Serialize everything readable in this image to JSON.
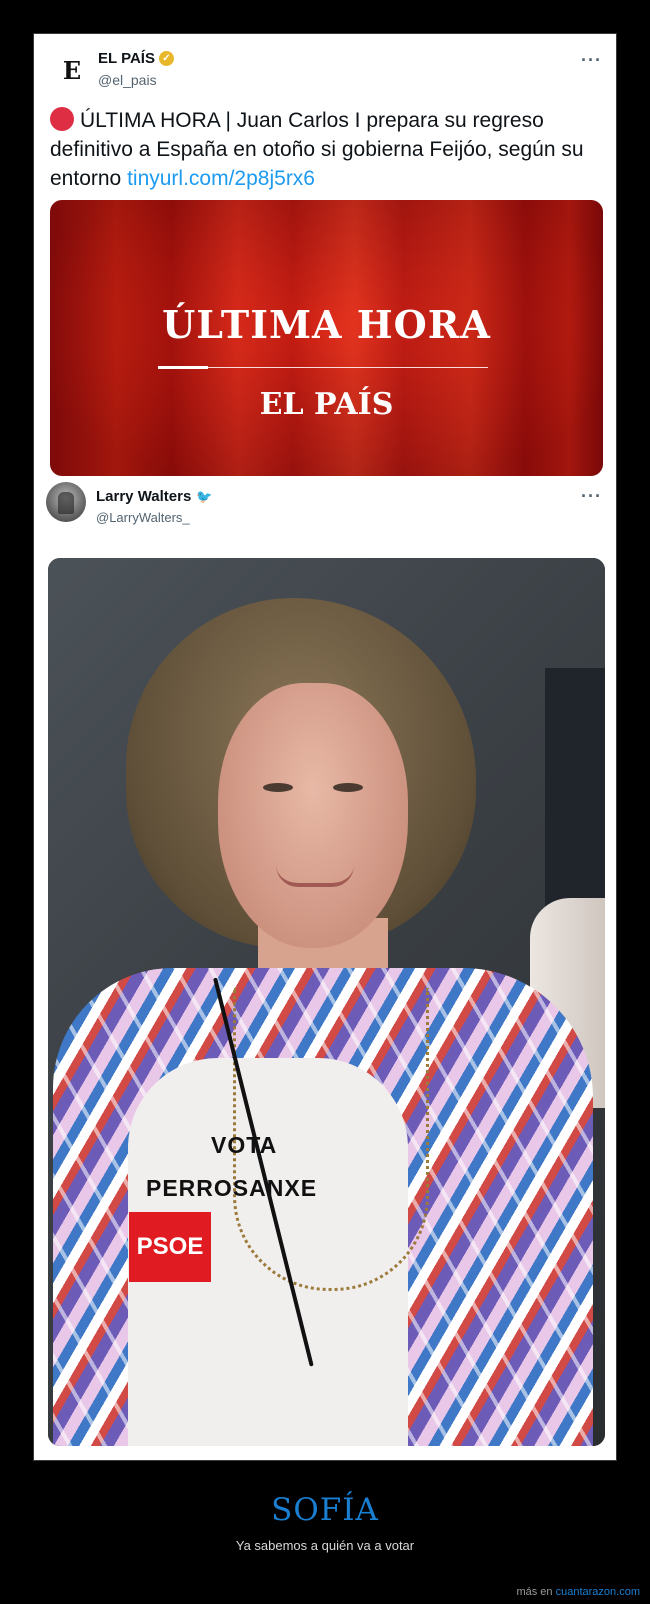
{
  "tweet1": {
    "author_name": "EL PAÍS",
    "handle": "@el_pais",
    "logo_letter": "E",
    "more": "···",
    "text": "ÚLTIMA HORA | Juan Carlos I prepara su regreso definitivo a España en otoño si gobierna Feijóo, según su entorno",
    "link": "tinyurl.com/2p8j5rx6",
    "card": {
      "title": "ÚLTIMA HORA",
      "brand": "EL PAÍS"
    }
  },
  "tweet2": {
    "author_name": "Larry Walters",
    "handle": "@LarryWalters_",
    "more": "···",
    "photo_text": {
      "line1": "VOTA",
      "line2": "PERROSANXE",
      "logo": "PSOE"
    }
  },
  "caption": {
    "title": "SOFÍA",
    "subtitle": "Ya sabemos a quién va a votar"
  },
  "footer": {
    "prefix": "más en",
    "site": "cuantarazon.com"
  },
  "colors": {
    "accent": "#1a7fd1",
    "twitter_link": "#1d9bf0",
    "psoe_red": "#e11b22",
    "card_red": "#d81f11"
  }
}
